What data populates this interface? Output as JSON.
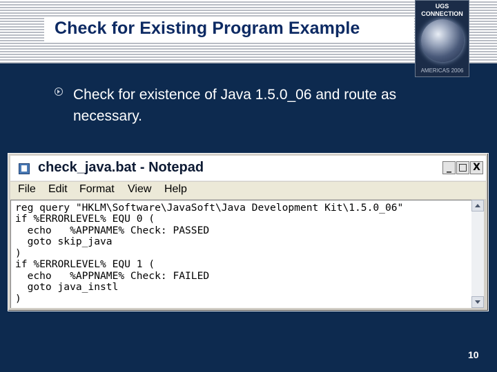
{
  "slide": {
    "title": "Check for Existing Program Example",
    "bullet": "Check for existence of Java 1.5.0_06 and route as necessary.",
    "page_number": "10"
  },
  "logo": {
    "line1": "UGS",
    "line2": "CONNECTION",
    "line3": "AMERICAS 2006"
  },
  "notepad": {
    "title": "check_java.bat - Notepad",
    "buttons": {
      "minimize": "_",
      "maximize": "□",
      "close": "X"
    },
    "menu": [
      "File",
      "Edit",
      "Format",
      "View",
      "Help"
    ],
    "lines": [
      "reg query \"HKLM\\Software\\JavaSoft\\Java Development Kit\\1.5.0_06\"",
      "if %ERRORLEVEL% EQU 0 (",
      "  echo   %APPNAME% Check: PASSED",
      "  goto skip_java",
      ")",
      "if %ERRORLEVEL% EQU 1 (",
      "  echo   %APPNAME% Check: FAILED",
      "  goto java_instl",
      ")"
    ]
  },
  "colors": {
    "background": "#0d2a4f",
    "title_text": "#0d2a63"
  }
}
